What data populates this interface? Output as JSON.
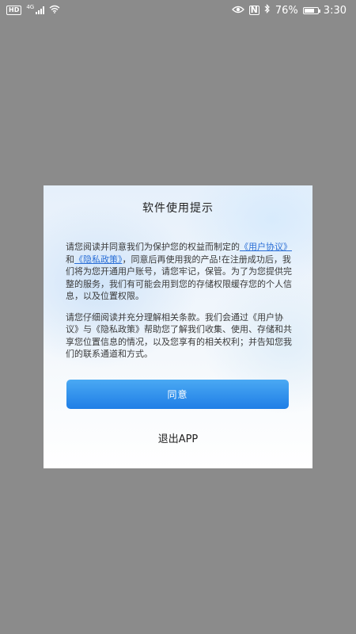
{
  "status_bar": {
    "hd_label": "HD",
    "network_type": "4G",
    "battery_percent": "76%",
    "battery_level": 0.76,
    "time": "3:30",
    "icons": [
      "signal-icon",
      "wifi-icon",
      "eye-icon",
      "nfc-icon",
      "bluetooth-icon",
      "battery-icon"
    ]
  },
  "dialog": {
    "title": "软件使用提示",
    "paragraph1": {
      "text_before": "请您阅读并同意我们为保护您的权益而制定的",
      "user_agreement_link": "《用户协议》",
      "text_and": "和",
      "privacy_policy_link": "《隐私政策》",
      "text_after": "，同意后再使用我的产品!在注册成功后，我们将为您开通用户账号，请您牢记，保管。为了为您提供完整的服务，我们有可能会用到您的存储权限缓存您的个人信息，以及位置权限。"
    },
    "paragraph2": "请您仔细阅读并充分理解相关条款。我们会通过《用户协议》与《隐私政策》帮助您了解我们收集、使用、存储和共享您位置信息的情况，以及您享有的相关权利；并告知您我们的联系通道和方式。",
    "agree_button_label": "同意",
    "exit_label": "退出APP"
  },
  "colors": {
    "overlay": "#8b8b8b",
    "link": "#2b6fd6",
    "button": "#2f8ff0",
    "text": "#3a3a3a"
  }
}
